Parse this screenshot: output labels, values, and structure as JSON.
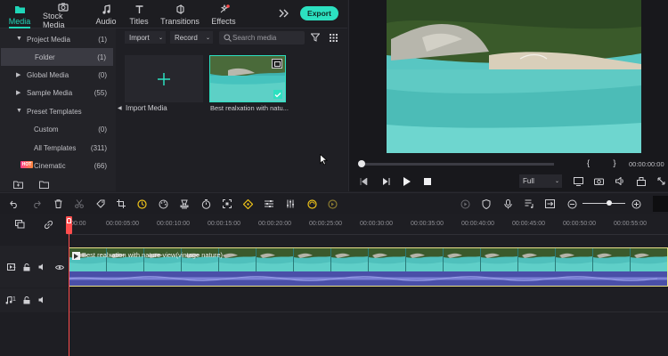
{
  "top_nav": {
    "tabs": [
      {
        "label": "Media",
        "icon": "folder-icon",
        "active": true
      },
      {
        "label": "Stock Media",
        "icon": "camera-icon",
        "active": false
      },
      {
        "label": "Audio",
        "icon": "music-note-icon",
        "active": false
      },
      {
        "label": "Titles",
        "icon": "text-t-icon",
        "active": false
      },
      {
        "label": "Transitions",
        "icon": "transition-icon",
        "active": false
      },
      {
        "label": "Effects",
        "icon": "effects-icon",
        "active": false
      }
    ],
    "more_icon": "double-chevron-right-icon",
    "export_label": "Export",
    "accent_color": "#2ce0c0",
    "notification_color": "#ff4d4d"
  },
  "sidebar": {
    "items": [
      {
        "label": "Project Media",
        "count": "(1)",
        "expanded": true
      },
      {
        "label": "Folder",
        "count": "(1)",
        "selected": true
      },
      {
        "label": "Global Media",
        "count": "(0)"
      },
      {
        "label": "Sample Media",
        "count": "(55)"
      },
      {
        "label": "Preset Templates",
        "count": "",
        "expanded": true
      },
      {
        "label": "Custom",
        "count": "(0)"
      },
      {
        "label": "All Templates",
        "count": "(311)"
      },
      {
        "label": "Cinematic",
        "count": "(66)",
        "badge": "HOT"
      }
    ],
    "bottom_icons": [
      "new-folder-icon",
      "folder-icon"
    ]
  },
  "media_toolbar": {
    "import_label": "Import",
    "record_label": "Record",
    "search_placeholder": "Search media",
    "filter_icon": "filter-icon",
    "grid_icon": "grid-icon"
  },
  "media_items": {
    "import_label": "Import Media",
    "clip_label": "Best realxation with natu..."
  },
  "preview": {
    "timecode": "00:00:00:00",
    "brackets": "{ }",
    "zoom": "Full",
    "progress": 0.0
  },
  "timeline": {
    "ruler_ticks": [
      "00:00",
      "00:00:05:00",
      "00:00:10:00",
      "00:00:15:00",
      "00:00:20:00",
      "00:00:25:00",
      "00:00:30:00",
      "00:00:35:00",
      "00:00:40:00",
      "00:00:45:00",
      "00:00:50:00",
      "00:00:55:00"
    ],
    "clip_title": "Best realxation with nature view(vintage nature)",
    "video_track_label": "1",
    "audio_track_label": "1",
    "playhead_color": "#ff4d4d",
    "clip_border_color": "#e8e088",
    "audio_wave_color": "#5a5fb8"
  }
}
